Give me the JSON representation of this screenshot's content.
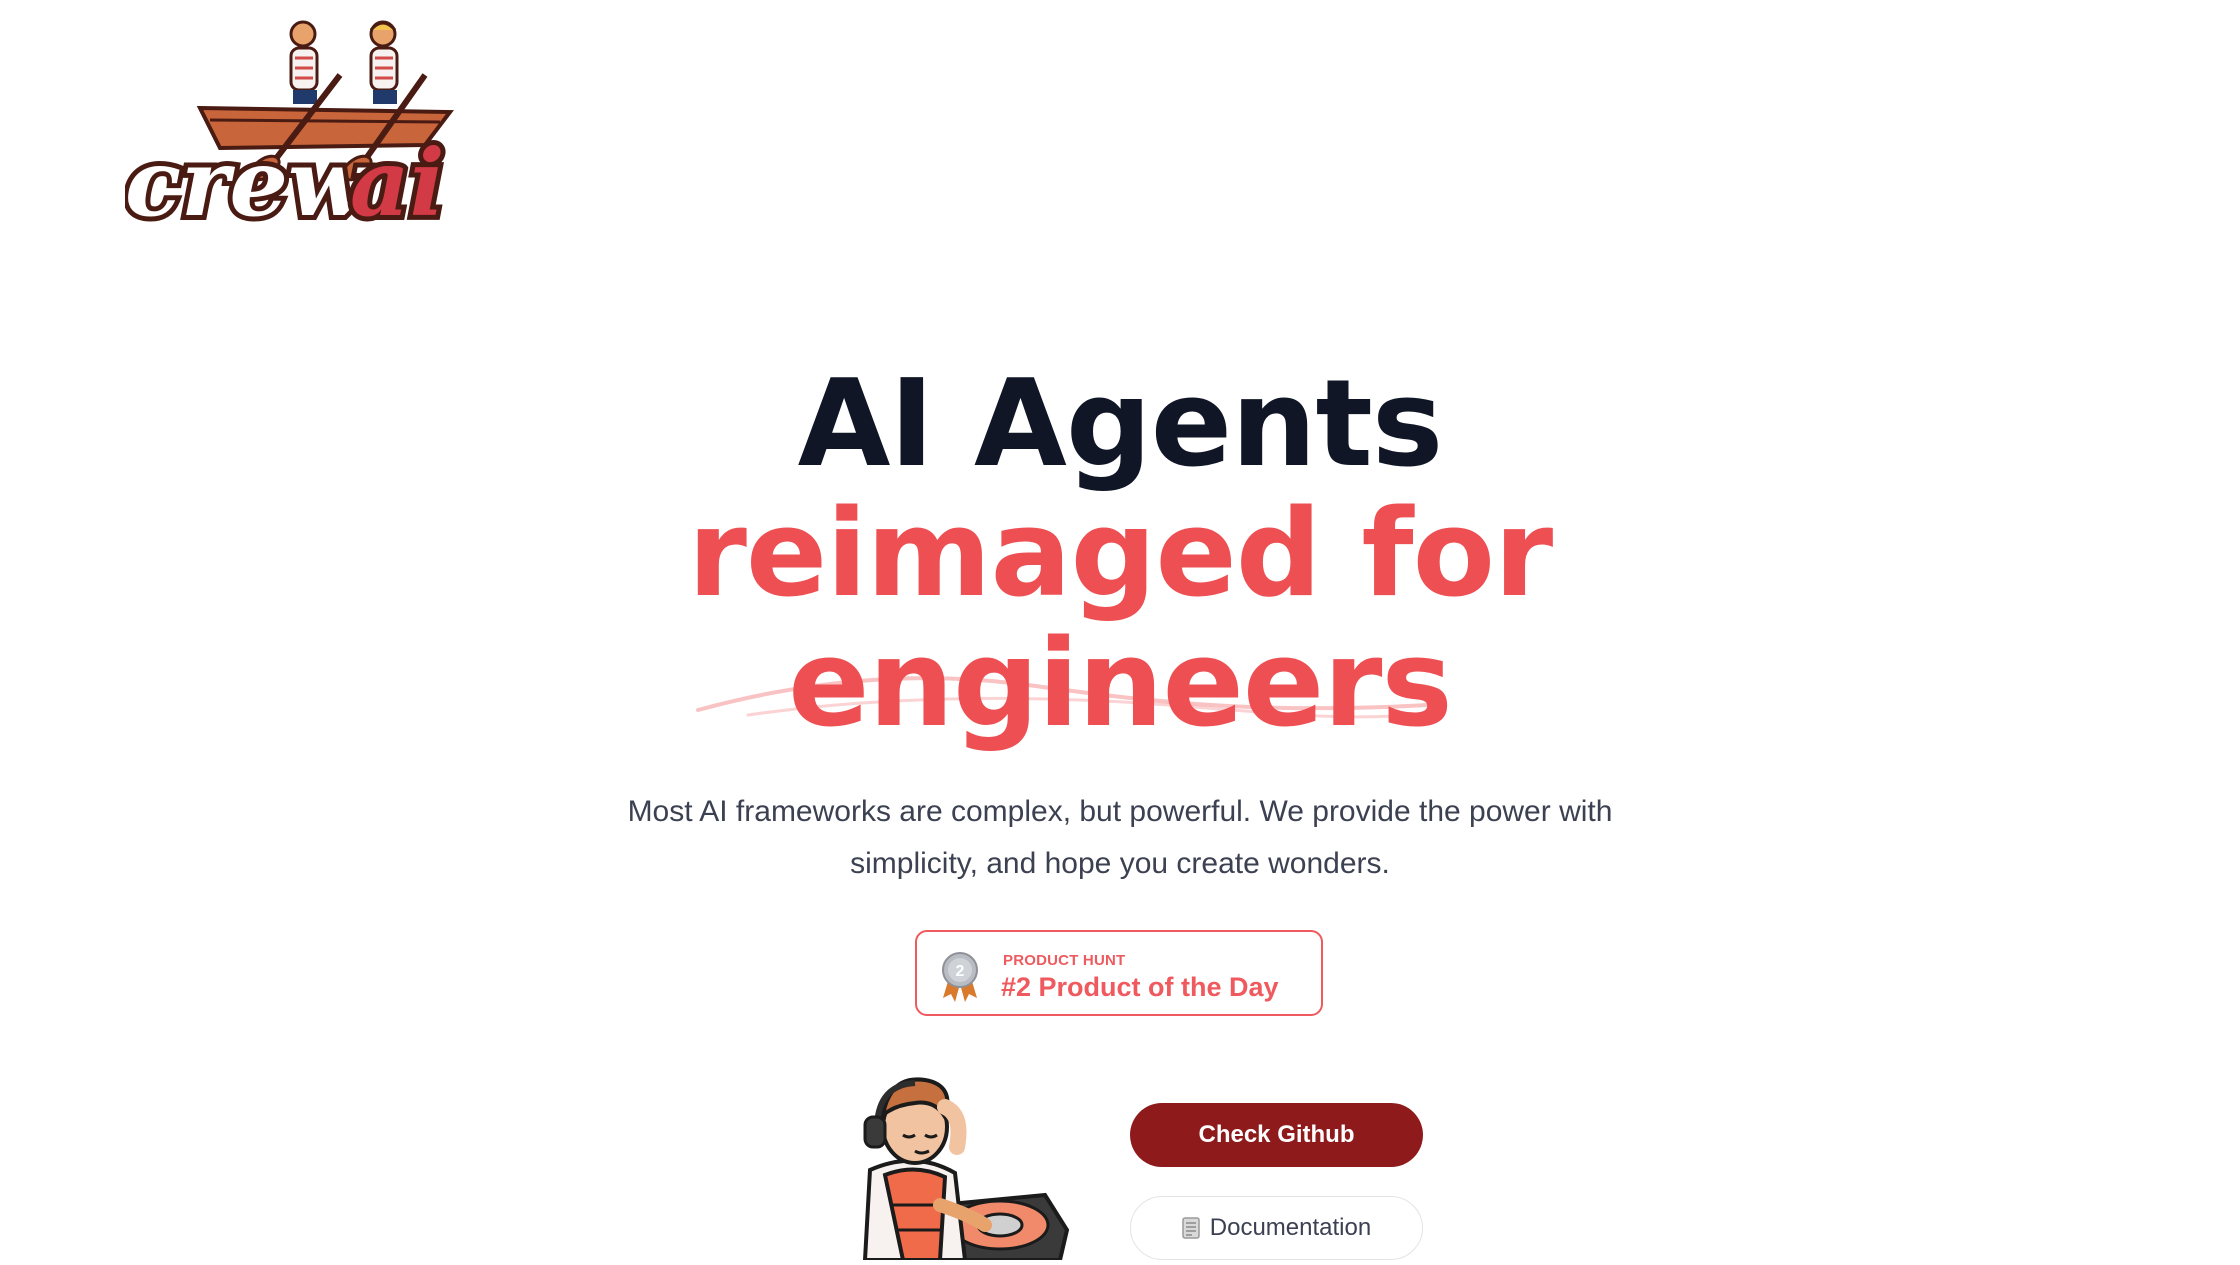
{
  "logo": {
    "text_crew": "crew",
    "text_ai": "ai"
  },
  "hero": {
    "line1": "AI Agents",
    "line2": "reimaged for",
    "line3": "engineers"
  },
  "subtitle": {
    "line1": "Most AI frameworks are complex, but powerful. We provide the power with",
    "line2": "simplicity, and hope you create wonders."
  },
  "product_hunt": {
    "kicker": "PRODUCT HUNT",
    "title": "#2 Product of the Day",
    "medal_number": "2"
  },
  "buttons": {
    "github": "Check Github",
    "docs": "Documentation"
  },
  "colors": {
    "accent": "#ee4f53",
    "dark": "#101626",
    "button": "#8e1a1b"
  }
}
